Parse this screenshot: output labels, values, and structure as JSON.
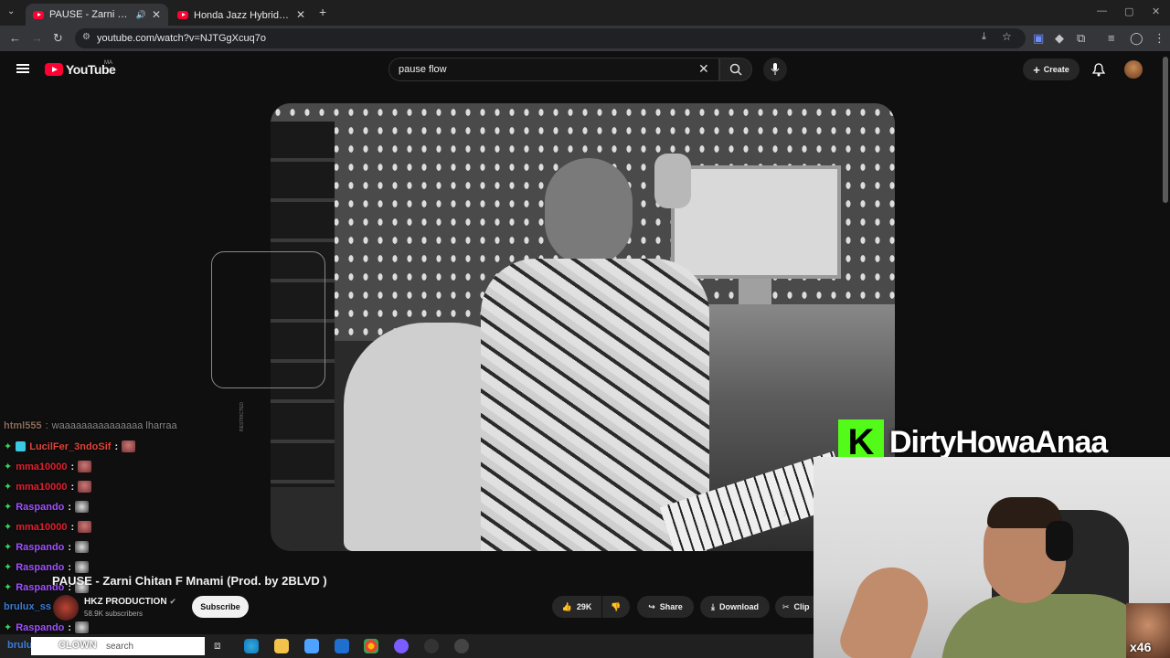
{
  "browser": {
    "tabs": [
      {
        "title": "PAUSE - Zarni Chitan F Mna…",
        "active": true
      },
      {
        "title": "Honda Jazz Hybrid : عروة فالمغرب",
        "active": false
      }
    ],
    "new_tab": "+",
    "url": "youtube.com/watch?v=NJTGgXcuq7o"
  },
  "youtube": {
    "logo_text": "YouTube",
    "region": "MA",
    "search_value": "pause flow",
    "create_label": "Create"
  },
  "video": {
    "title": "PAUSE - Zarni Chitan F Mnami (Prod. by 2BLVD )",
    "channel": "HKZ PRODUCTION",
    "subscribers": "58.9K subscribers",
    "subscribe_label": "Subscribe",
    "likes": "29K",
    "share_label": "Share",
    "download_label": "Download",
    "clip_label": "Clip",
    "side_label": "RESTRICTED"
  },
  "stream_overlay": {
    "chat": [
      {
        "user": "html555",
        "message": "waaaaaaaaaaaaaaa lharraa",
        "color": "#8a6a5a"
      },
      {
        "user": "LucilFer_3ndoSif",
        "message": "",
        "color": "#e0453a"
      },
      {
        "user": "mma10000",
        "message": "",
        "color": "#e02030"
      },
      {
        "user": "mma10000",
        "message": "",
        "color": "#e02030"
      },
      {
        "user": "Raspando",
        "message": "",
        "color": "#a050ff"
      },
      {
        "user": "mma10000",
        "message": "",
        "color": "#e02030"
      },
      {
        "user": "Raspando",
        "message": "",
        "color": "#a050ff"
      },
      {
        "user": "Raspando",
        "message": "",
        "color": "#a050ff"
      },
      {
        "user": "Raspando",
        "message": "",
        "color": "#a050ff"
      },
      {
        "user": "brulux_ss",
        "message": "",
        "color": "#3a7bd5"
      },
      {
        "user": "Raspando",
        "message": "",
        "color": "#a050ff"
      }
    ],
    "kick_letter": "K",
    "streamer": "DirtyHowaAnaa",
    "multiplier": "x46",
    "bottom_tag": "CLOWN",
    "bottom_user": "brulux_ss"
  },
  "taskbar": {
    "search_placeholder": "search"
  },
  "colors": {
    "kick_green": "#53fc18",
    "yt_red": "#ff0033",
    "chat_gem": "#3bd15a"
  }
}
